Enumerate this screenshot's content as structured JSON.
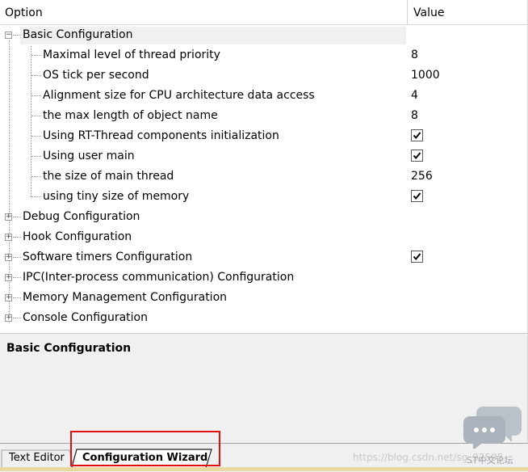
{
  "grid": {
    "header": {
      "option": "Option",
      "value": "Value"
    },
    "groups": [
      {
        "label": "Basic Configuration",
        "expanded": true,
        "selected": true,
        "expander": "−",
        "items": [
          {
            "label": "Maximal level of thread priority",
            "value": "8",
            "checkbox": false
          },
          {
            "label": "OS tick per second",
            "value": "1000",
            "checkbox": false
          },
          {
            "label": "Alignment size for CPU architecture data access",
            "value": "4",
            "checkbox": false
          },
          {
            "label": "the max length of object name",
            "value": "8",
            "checkbox": false
          },
          {
            "label": "Using RT-Thread components initialization",
            "value": "",
            "checkbox": true,
            "checked": true
          },
          {
            "label": "Using user main",
            "value": "",
            "checkbox": true,
            "checked": true
          },
          {
            "label": "the size of main thread",
            "value": "256",
            "checkbox": false
          },
          {
            "label": "using tiny size of memory",
            "value": "",
            "checkbox": true,
            "checked": true
          }
        ]
      },
      {
        "label": "Debug Configuration",
        "expanded": false,
        "expander": "+",
        "checkbox": false
      },
      {
        "label": "Hook Configuration",
        "expanded": false,
        "expander": "+",
        "checkbox": false
      },
      {
        "label": "Software timers Configuration",
        "expanded": false,
        "expander": "+",
        "checkbox": true,
        "checked": true
      },
      {
        "label": "IPC(Inter-process communication) Configuration",
        "expanded": false,
        "expander": "+",
        "checkbox": false
      },
      {
        "label": "Memory Management Configuration",
        "expanded": false,
        "expander": "+",
        "checkbox": false
      },
      {
        "label": "Console Configuration",
        "expanded": false,
        "expander": "+",
        "checkbox": false
      }
    ]
  },
  "description": {
    "title": "Basic Configuration"
  },
  "tabs": [
    {
      "label": "Text Editor",
      "active": false
    },
    {
      "label": "Configuration Wizard",
      "active": true
    }
  ],
  "watermark": {
    "url": "https://blog.csdn.net/sg_92595",
    "brand": "ST中文论坛"
  },
  "colors": {
    "highlight_box": "#e01010",
    "selected_row": "#f0f0f0",
    "panel_bg": "#f0f0f0",
    "status_strip": "#e8d9a0"
  },
  "icons": {
    "expander_expanded": "minus-box-icon",
    "expander_collapsed": "plus-box-icon",
    "checked": "checkmark-icon",
    "watermark_logo": "chat-bubbles-icon"
  }
}
